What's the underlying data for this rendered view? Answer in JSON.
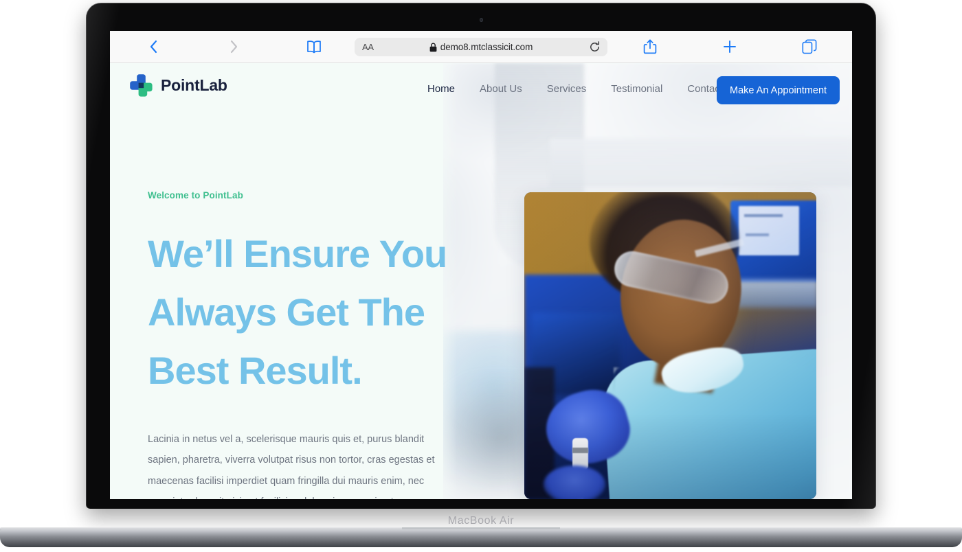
{
  "device": {
    "label": "MacBook Air"
  },
  "browser": {
    "name": "safari",
    "back_icon": "chevron-left-icon",
    "forward_icon": "chevron-right-icon",
    "reader_icon": "book-icon",
    "text_size_label": "AA",
    "lock_icon": "lock-icon",
    "url": "demo8.mtclassicit.com",
    "reload_icon": "reload-icon",
    "share_icon": "share-icon",
    "new_tab_icon": "plus-icon",
    "tabs_icon": "tabs-icon"
  },
  "site": {
    "brand": {
      "name": "PointLab",
      "logo_icon": "medical-cross-logo",
      "logo_blue": "#2563c9",
      "logo_green": "#2dbd83",
      "logo_dark": "#12365c"
    },
    "nav": {
      "items": [
        {
          "label": "Home",
          "active": true
        },
        {
          "label": "About Us",
          "active": false
        },
        {
          "label": "Services",
          "active": false
        },
        {
          "label": "Testimonial",
          "active": false
        },
        {
          "label": "Contact Us",
          "active": false
        }
      ],
      "cta_label": "Make An Appointment",
      "cta_color": "#1664d6"
    },
    "hero": {
      "eyebrow": "Welcome to PointLab",
      "eyebrow_color": "#3fbf8f",
      "heading": "We’ll Ensure You Always Get The Best Result.",
      "heading_color": "#74c2e8",
      "paragraph": "Lacinia in netus vel a, scelerisque mauris quis et, purus blandit sapien, pharetra, viverra volutpat risus non tortor, cras egestas et maecenas facilisi imperdiet quam fringilla dui mauris enim, nec arcu, interdum sit nisi est facilisi sodales viverra proin et.",
      "image_alt": "lab-technician-photo",
      "background_color": "#f4fbf8"
    }
  }
}
